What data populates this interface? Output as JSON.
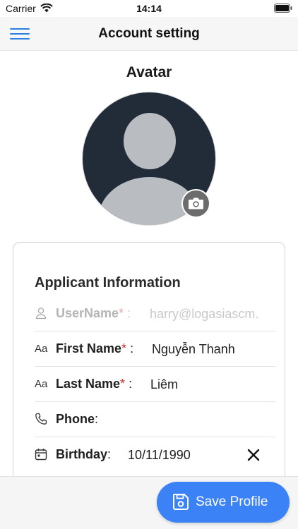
{
  "status_bar": {
    "carrier": "Carrier",
    "time": "14:14"
  },
  "nav": {
    "title": "Account setting",
    "menu_icon": "hamburger-menu-icon"
  },
  "avatar": {
    "heading": "Avatar",
    "camera_icon": "camera-icon"
  },
  "form": {
    "section_title": "Applicant Information",
    "fields": {
      "username": {
        "label": "UserName",
        "required": "*",
        "colon": " :",
        "value": "harry@logasiascm.",
        "icon": "person-icon"
      },
      "first_name": {
        "label": "First Name",
        "required": "*",
        "colon": " :",
        "value": "Nguyễn Thanh",
        "icon": "Aa"
      },
      "last_name": {
        "label": "Last Name",
        "required": "*",
        "colon": " :",
        "value": "Liêm",
        "icon": "Aa"
      },
      "phone": {
        "label": "Phone",
        "colon": ":",
        "value": "",
        "icon": "phone-icon"
      },
      "birthday": {
        "label": "Birthday",
        "colon": ":",
        "value": "10/11/1990",
        "icon": "calendar-icon",
        "clear_icon": "close-icon"
      }
    }
  },
  "footer": {
    "save_label": "Save Profile",
    "save_icon": "floppy-disk-icon"
  },
  "colors": {
    "accent": "#3b82f6",
    "menu": "#2a7fe4",
    "required": "#d0312d",
    "avatar_bg": "#222c38"
  }
}
